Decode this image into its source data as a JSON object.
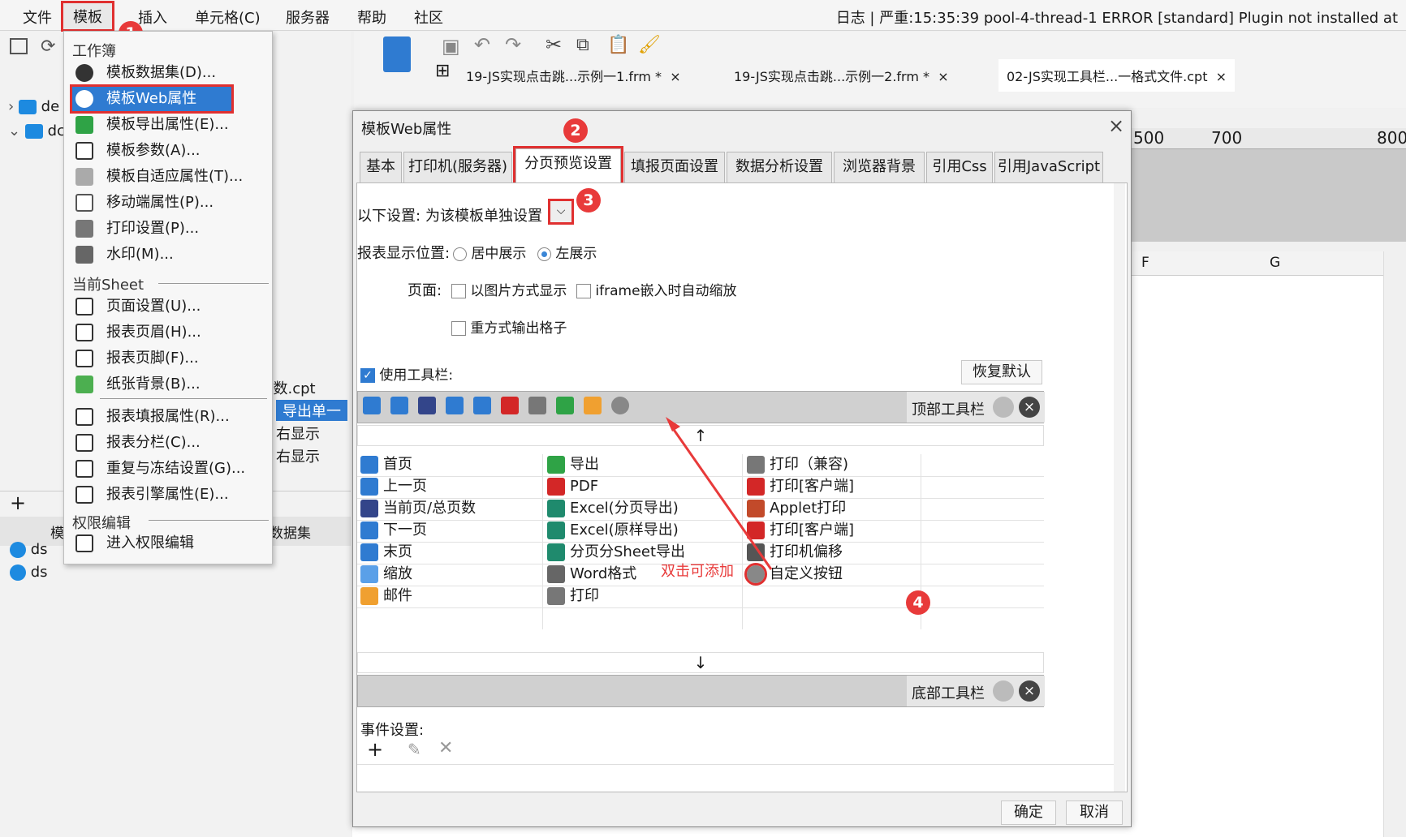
{
  "menubar": {
    "items": [
      "文件",
      "模板",
      "插入",
      "单元格(C)",
      "服务器",
      "帮助",
      "社区"
    ],
    "log": "日志 | 严重:15:35:39 pool-4-thread-1 ERROR [standard] Plugin not installed at"
  },
  "dropdown": {
    "sec_workbook": "工作簿",
    "items_wb": [
      "模板数据集(D)...",
      "模板Web属性(W)...",
      "模板导出属性(E)...",
      "模板参数(A)...",
      "模板自适应属性(T)...",
      "移动端属性(P)...",
      "打印设置(P)...",
      "水印(M)..."
    ],
    "sec_sheet": "当前Sheet",
    "items_sheet": [
      "页面设置(U)...",
      "报表页眉(H)...",
      "报表页脚(F)...",
      "纸张背景(B)..."
    ],
    "items_sheet2": [
      "报表填报属性(R)...",
      "报表分栏(C)...",
      "重复与冻结设置(G)...",
      "报表引擎属性(E)..."
    ],
    "sec_perm": "权限编辑",
    "items_perm": [
      "进入权限编辑"
    ]
  },
  "left_tree": {
    "rows": [
      "de",
      "dc"
    ],
    "files": [
      "-数.cpt",
      "导出单一",
      "右显示",
      "右显示"
    ],
    "dataset_rows": [
      "ds",
      "ds"
    ],
    "dataset_label": "数据集",
    "mod": "模"
  },
  "tabs_docs": [
    "19-JS实现点击跳...示例一1.frm *",
    "19-JS实现点击跳...示例一2.frm *",
    "02-JS实现工具栏...一格式文件.cpt"
  ],
  "ruler": [
    "500",
    "700",
    "800"
  ],
  "sheet_cols": [
    "F",
    "G"
  ],
  "dialog": {
    "title": "模板Web属性",
    "tabs": [
      "基本",
      "打印机(服务器)",
      "分页预览设置",
      "填报页面设置",
      "数据分析设置",
      "浏览器背景",
      "引用Css",
      "引用JavaScript"
    ],
    "settings_label": "以下设置:",
    "settings_value": "为该模板单独设置",
    "pos_label": "报表显示位置:",
    "pos_center": "居中展示",
    "pos_left": "左展示",
    "page_label": "页面:",
    "page_opt1": "以图片方式显示",
    "page_opt2": "iframe嵌入时自动缩放",
    "page_opt3": "重方式输出格子",
    "use_toolbar": "使用工具栏:",
    "restore": "恢复默认",
    "top_toolbar": "顶部工具栏",
    "bottom_toolbar": "底部工具栏",
    "col1": [
      "首页",
      "上一页",
      "当前页/总页数",
      "下一页",
      "末页",
      "缩放",
      "邮件"
    ],
    "col2": [
      "导出",
      "PDF",
      "Excel(分页导出)",
      "Excel(原样导出)",
      "分页分Sheet导出",
      "Word格式",
      "打印"
    ],
    "col3": [
      "打印（兼容)",
      "打印[客户端]",
      "Applet打印",
      "打印[客户端]",
      "打印机偏移",
      "自定义按钮"
    ],
    "annotation": "双击可添加",
    "event_label": "事件设置:",
    "ok": "确定",
    "cancel": "取消"
  },
  "badges": [
    "1",
    "2",
    "3",
    "4"
  ],
  "colors": {
    "accent": "#2f7bd1",
    "highlight": "#e03030",
    "select": "#2f7bd1"
  }
}
